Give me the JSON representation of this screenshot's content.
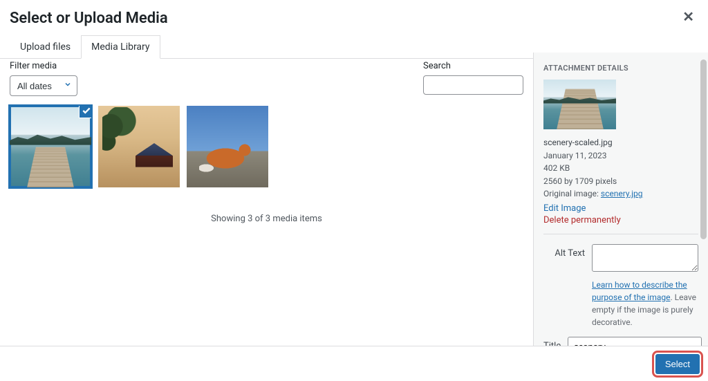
{
  "header": {
    "title": "Select or Upload Media"
  },
  "tabs": {
    "upload": "Upload files",
    "library": "Media Library"
  },
  "filter": {
    "label": "Filter media",
    "dates_value": "All dates"
  },
  "search": {
    "label": "Search"
  },
  "status": {
    "count_text": "Showing 3 of 3 media items"
  },
  "sidebar": {
    "heading": "ATTACHMENT DETAILS",
    "filename": "scenery-scaled.jpg",
    "date": "January 11, 2023",
    "filesize": "402 KB",
    "dimensions": "2560 by 1709 pixels",
    "original_label": "Original image: ",
    "original_link": "scenery.jpg",
    "edit_link": "Edit Image",
    "delete_link": "Delete permanently",
    "alt_label": "Alt Text",
    "alt_hint_link": "Learn how to describe the purpose of the image",
    "alt_hint_rest": ". Leave empty if the image is purely decorative.",
    "title_label": "Title",
    "title_value": "scenery"
  },
  "footer": {
    "select_label": "Select"
  }
}
